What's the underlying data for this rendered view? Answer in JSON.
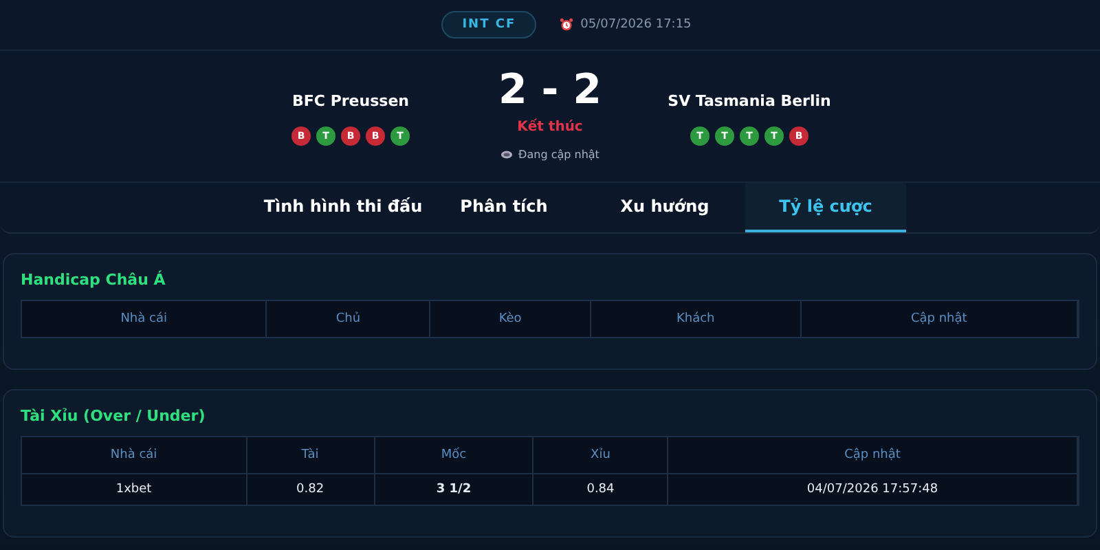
{
  "header": {
    "league": "INT CF",
    "datetime": "05/07/2026 17:15"
  },
  "match": {
    "home": {
      "name": "BFC Preussen",
      "form": [
        {
          "letter": "B",
          "color": "#c62a36"
        },
        {
          "letter": "T",
          "color": "#2e9a3f"
        },
        {
          "letter": "B",
          "color": "#c62a36"
        },
        {
          "letter": "B",
          "color": "#c62a36"
        },
        {
          "letter": "T",
          "color": "#2e9a3f"
        }
      ]
    },
    "score": "2 - 2",
    "status": "Kết thúc",
    "update_note": "Đang cập nhật",
    "away": {
      "name": "SV Tasmania Berlin",
      "form": [
        {
          "letter": "T",
          "color": "#2e9a3f"
        },
        {
          "letter": "T",
          "color": "#2e9a3f"
        },
        {
          "letter": "T",
          "color": "#2e9a3f"
        },
        {
          "letter": "T",
          "color": "#2e9a3f"
        },
        {
          "letter": "B",
          "color": "#c62a36"
        }
      ]
    }
  },
  "tabs": [
    {
      "label": "Tình hình thi đấu",
      "selected": false
    },
    {
      "label": "Phân tích",
      "selected": false
    },
    {
      "label": "Xu hướng",
      "selected": false
    },
    {
      "label": "Tỷ lệ cược",
      "selected": true
    }
  ],
  "sections": [
    {
      "title": "Handicap Châu Á",
      "columns": [
        "Nhà cái",
        "Chủ",
        "Kèo",
        "Khách",
        "Cập nhật"
      ]
    },
    {
      "title": "Tài Xỉu (Over / Under)",
      "columns": [
        "Nhà cái",
        "Tài",
        "Mốc",
        "Xỉu",
        "Cập nhật"
      ],
      "rows": [
        [
          "1xbet",
          "0.82",
          "3 1/2",
          "0.84",
          "04/07/2026 17:57:48"
        ]
      ]
    }
  ]
}
